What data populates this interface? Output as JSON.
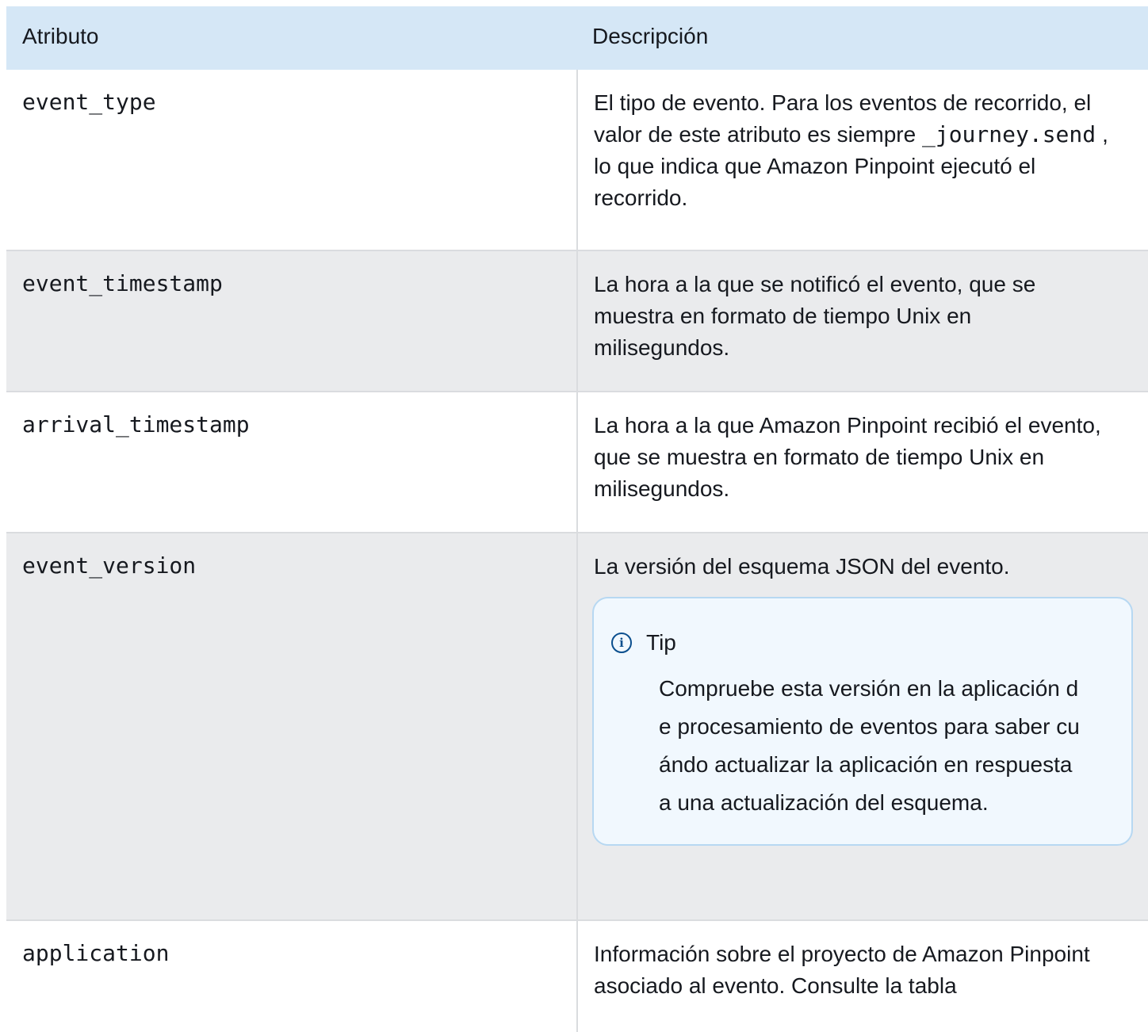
{
  "table": {
    "headers": {
      "attribute": "Atributo",
      "description": "Descripción"
    },
    "rows": [
      {
        "attribute": "event_type",
        "description_before": "El tipo de evento. Para los eventos de recorrido, el valor de este atributo es siempre ",
        "description_code": "_journey.send",
        "description_after": ", lo que indica que Amazon Pinpoint ejecutó el recorrido."
      },
      {
        "attribute": "event_timestamp",
        "description": "La hora a la que se notificó el evento, que se muestra en formato de tiempo Unix en milisegundos."
      },
      {
        "attribute": "arrival_timestamp",
        "description": "La hora a la que Amazon Pinpoint recibió el evento, que se muestra en formato de tiempo Unix en milisegundos."
      },
      {
        "attribute": "event_version",
        "description": "La versión del esquema JSON del evento.",
        "tip": {
          "icon": "info-icon",
          "title": "Tip",
          "body": "Compruebe esta versión en la aplicación de procesamiento de eventos para saber cuándo actualizar la aplicación en respuesta a una actualización del esquema."
        }
      },
      {
        "attribute": "application",
        "description": "Información sobre el proyecto de Amazon Pinpoint asociado al evento. Consulte la tabla"
      }
    ]
  }
}
